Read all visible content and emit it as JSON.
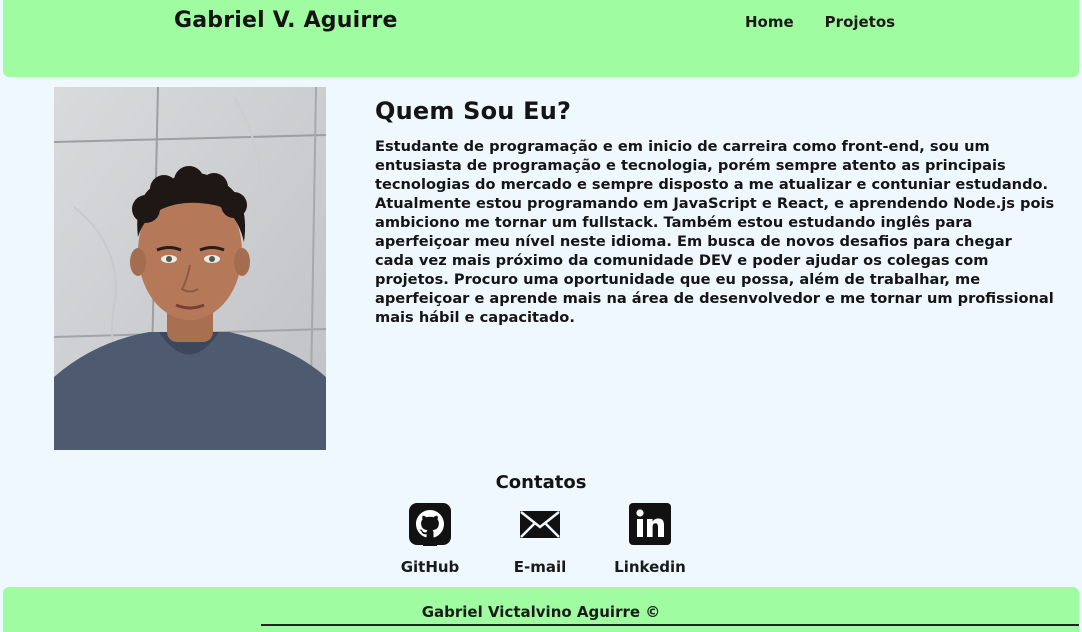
{
  "header": {
    "brand": "Gabriel V. Aguirre",
    "nav": [
      {
        "label": "Home"
      },
      {
        "label": "Projetos"
      }
    ]
  },
  "about": {
    "heading": "Quem Sou Eu?",
    "text": "Estudante de programação e em inicio de carreira como front-end, sou um entusiasta de programação e tecnologia, porém sempre atento as principais tecnologias do mercado e sempre disposto a me atualizar e contuniar estudando. Atualmente estou programando em JavaScript e React, e aprendendo Node.js pois ambiciono me tornar um fullstack. Também estou estudando inglês para aperfeiçoar meu nível neste idioma. Em busca de novos desafios para chegar cada vez mais próximo da comunidade DEV e poder ajudar os colegas com projetos. Procuro uma oportunidade que eu possa, além de trabalhar, me aperfeiçoar e aprende mais na área de desenvolvedor e me tornar um profissional mais hábil e capacitado."
  },
  "contacts": {
    "title": "Contatos",
    "items": [
      {
        "label": "GitHub",
        "icon": "github-icon"
      },
      {
        "label": "E-mail",
        "icon": "envelope-icon"
      },
      {
        "label": "Linkedin",
        "icon": "linkedin-icon"
      }
    ]
  },
  "footer": {
    "text": "Gabriel Victalvino Aguirre ©"
  },
  "colors": {
    "accent_green": "#a0fca0",
    "background": "#f0f8ff",
    "text": "#141414"
  }
}
